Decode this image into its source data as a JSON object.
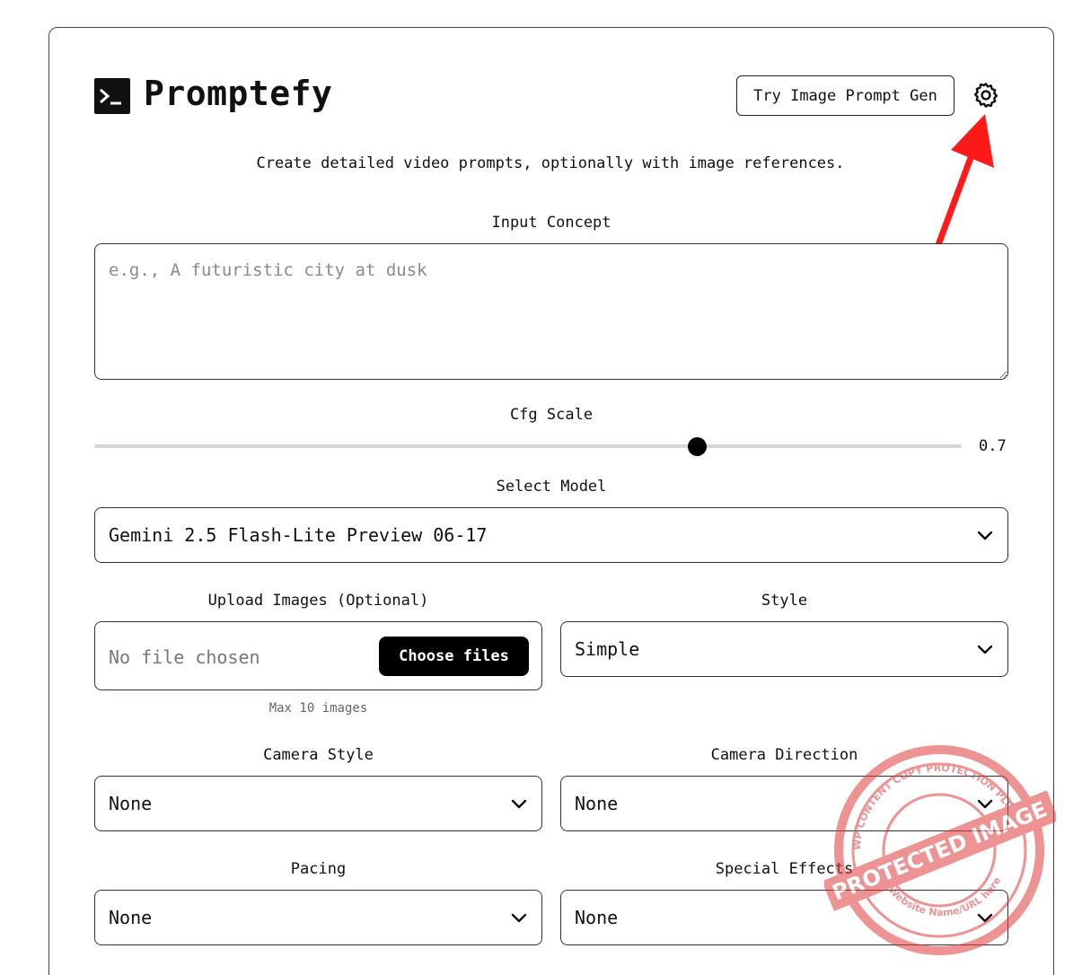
{
  "app": {
    "title": "Promptefy",
    "subtitle": "Create detailed video prompts, optionally with image references."
  },
  "header": {
    "try_button": "Try Image Prompt Gen",
    "settings_icon": "gear-icon"
  },
  "concept": {
    "label": "Input Concept",
    "placeholder": "e.g., A futuristic city at dusk",
    "value": ""
  },
  "cfg": {
    "label": "Cfg Scale",
    "value": "0.7"
  },
  "model": {
    "label": "Select Model",
    "selected": "Gemini 2.5 Flash-Lite Preview 06-17"
  },
  "upload": {
    "label": "Upload Images (Optional)",
    "status": "No file chosen",
    "button": "Choose files",
    "hint": "Max 10 images"
  },
  "style": {
    "label": "Style",
    "selected": "Simple"
  },
  "camera_style": {
    "label": "Camera Style",
    "selected": "None"
  },
  "camera_direction": {
    "label": "Camera Direction",
    "selected": "None"
  },
  "pacing": {
    "label": "Pacing",
    "selected": "None"
  },
  "special_effects": {
    "label": "Special Effects",
    "selected": "None"
  },
  "watermark": {
    "text": "PROTECTED IMAGE",
    "ring_text": "WP CONTENT COPY PROTECTION PLUGIN",
    "bottom_text": "My Website Name/URL here"
  },
  "colors": {
    "accent": "#000000",
    "annotation_arrow": "#ff1a1a",
    "stamp": "#e03b3b"
  }
}
